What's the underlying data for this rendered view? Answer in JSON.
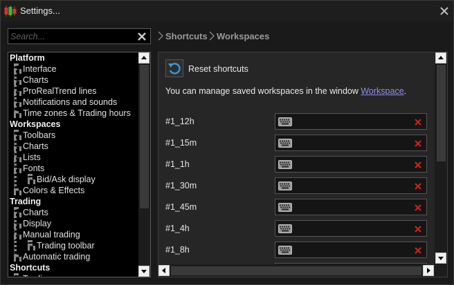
{
  "window": {
    "title": "Settings...",
    "icon": "candlestick-app-icon",
    "close_icon": "close-icon"
  },
  "search": {
    "placeholder": "Search...",
    "value": ""
  },
  "breadcrumb": [
    "Shortcuts",
    "Workspaces"
  ],
  "tree": [
    {
      "label": "Platform",
      "level": 0
    },
    {
      "label": "Interface",
      "level": 1
    },
    {
      "label": "Charts",
      "level": 1
    },
    {
      "label": "ProRealTrend lines",
      "level": 1
    },
    {
      "label": "Notifications and sounds",
      "level": 1
    },
    {
      "label": "Time zones & Trading hours",
      "level": 1
    },
    {
      "label": "Workspaces",
      "level": 0
    },
    {
      "label": "Toolbars",
      "level": 1
    },
    {
      "label": "Charts",
      "level": 1
    },
    {
      "label": "Lists",
      "level": 1
    },
    {
      "label": "Fonts",
      "level": 1
    },
    {
      "label": "Bid/Ask display",
      "level": 2
    },
    {
      "label": "Colors & Effects",
      "level": 1
    },
    {
      "label": "Trading",
      "level": 0
    },
    {
      "label": "Charts",
      "level": 1
    },
    {
      "label": "Display",
      "level": 1
    },
    {
      "label": "Manual trading",
      "level": 1
    },
    {
      "label": "Trading toolbar",
      "level": 2
    },
    {
      "label": "Automatic trading",
      "level": 1
    },
    {
      "label": "Shortcuts",
      "level": 0
    },
    {
      "label": "Trading",
      "level": 1
    }
  ],
  "content": {
    "reset_label": "Reset shortcuts",
    "info_text": "You can manage saved workspaces in the window ",
    "info_link": "Workspace",
    "info_end": ".",
    "shortcuts": [
      {
        "name": "#1_12h",
        "value": ""
      },
      {
        "name": "#1_15m",
        "value": ""
      },
      {
        "name": "#1_1h",
        "value": ""
      },
      {
        "name": "#1_30m",
        "value": ""
      },
      {
        "name": "#1_45m",
        "value": ""
      },
      {
        "name": "#1_4h",
        "value": ""
      },
      {
        "name": "#1_8h",
        "value": ""
      }
    ]
  },
  "colors": {
    "background": "#1a1a1a",
    "panel": "#262626",
    "link": "#8f8ff0",
    "delete": "#d02020",
    "reset_icon": "#3a9ad9"
  }
}
